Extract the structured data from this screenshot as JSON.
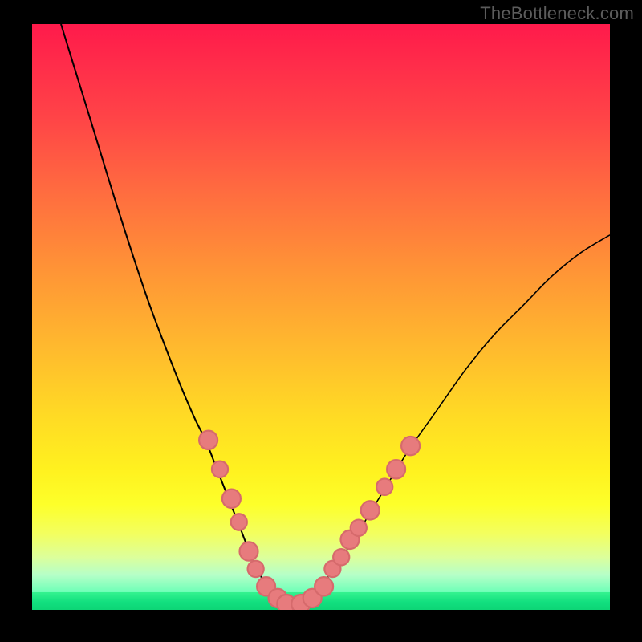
{
  "watermark": "TheBottleneck.com",
  "colors": {
    "gradient_top": "#ff1a4b",
    "gradient_bottom": "#15f58a",
    "curve": "#000000",
    "dots": "#e77b7d"
  },
  "chart_data": {
    "type": "line",
    "title": "",
    "xlabel": "",
    "ylabel": "",
    "xlim": [
      0,
      100
    ],
    "ylim": [
      0,
      100
    ],
    "series": [
      {
        "name": "bottleneck-curve",
        "x": [
          5,
          10,
          15,
          20,
          25,
          28,
          30,
          32,
          34,
          36,
          38,
          40,
          42,
          44,
          46,
          48,
          50,
          55,
          60,
          65,
          70,
          75,
          80,
          85,
          90,
          95,
          100
        ],
        "y": [
          100,
          84,
          68,
          53,
          40,
          33,
          29,
          24,
          19,
          14,
          9,
          5,
          2,
          1,
          1,
          2,
          4,
          11,
          19,
          27,
          34,
          41,
          47,
          52,
          57,
          61,
          64
        ]
      }
    ],
    "dots": {
      "name": "data-points",
      "points": [
        {
          "x": 30.5,
          "y": 29,
          "r": 1.6
        },
        {
          "x": 32.5,
          "y": 24,
          "r": 1.4
        },
        {
          "x": 34.5,
          "y": 19,
          "r": 1.6
        },
        {
          "x": 35.8,
          "y": 15,
          "r": 1.4
        },
        {
          "x": 37.5,
          "y": 10,
          "r": 1.6
        },
        {
          "x": 38.7,
          "y": 7,
          "r": 1.4
        },
        {
          "x": 40.5,
          "y": 4,
          "r": 1.6
        },
        {
          "x": 42.5,
          "y": 2,
          "r": 1.6
        },
        {
          "x": 44.0,
          "y": 1,
          "r": 1.6
        },
        {
          "x": 46.5,
          "y": 1,
          "r": 1.6
        },
        {
          "x": 48.5,
          "y": 2,
          "r": 1.6
        },
        {
          "x": 50.5,
          "y": 4,
          "r": 1.6
        },
        {
          "x": 52.0,
          "y": 7,
          "r": 1.4
        },
        {
          "x": 53.5,
          "y": 9,
          "r": 1.4
        },
        {
          "x": 55.0,
          "y": 12,
          "r": 1.6
        },
        {
          "x": 56.5,
          "y": 14,
          "r": 1.4
        },
        {
          "x": 58.5,
          "y": 17,
          "r": 1.6
        },
        {
          "x": 61.0,
          "y": 21,
          "r": 1.4
        },
        {
          "x": 63.0,
          "y": 24,
          "r": 1.6
        },
        {
          "x": 65.5,
          "y": 28,
          "r": 1.6
        }
      ]
    }
  }
}
